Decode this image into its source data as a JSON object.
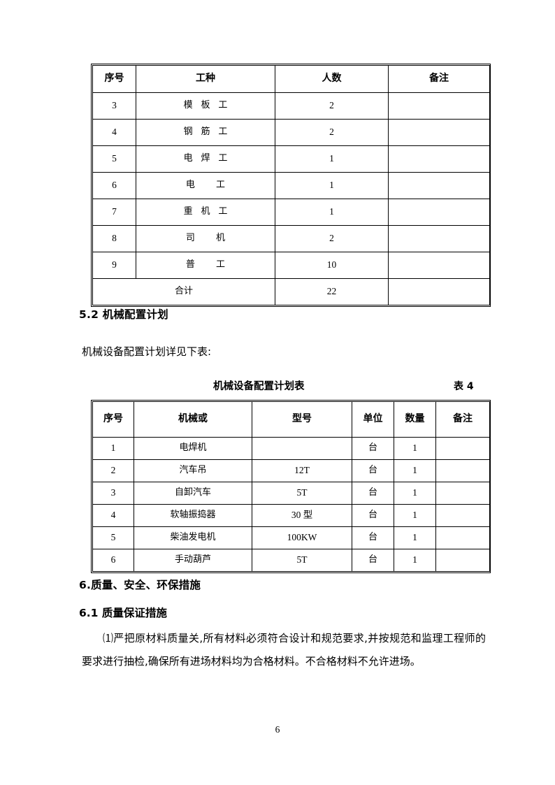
{
  "page": {
    "number": "6"
  },
  "table_labor": {
    "columns": [
      "序号",
      "工种",
      "人数",
      "备注"
    ],
    "rows": [
      {
        "no": "3",
        "trade": "模 板 工",
        "count": "2",
        "remark": ""
      },
      {
        "no": "4",
        "trade": "钢 筋 工",
        "count": "2",
        "remark": ""
      },
      {
        "no": "5",
        "trade": "电 焊 工",
        "count": "1",
        "remark": ""
      },
      {
        "no": "6",
        "trade": "电  工",
        "count": "1",
        "remark": ""
      },
      {
        "no": "7",
        "trade": "重 机 工",
        "count": "1",
        "remark": ""
      },
      {
        "no": "8",
        "trade": "司  机",
        "count": "2",
        "remark": ""
      },
      {
        "no": "9",
        "trade": "普  工",
        "count": "10",
        "remark": ""
      }
    ],
    "total_label": "合计",
    "total_count": "22",
    "total_remark": ""
  },
  "section_5_2": {
    "heading": "5.2 机械配置计划",
    "intro": "机械设备配置计划详见下表:"
  },
  "table_machine": {
    "caption": "机械设备配置计划表",
    "label": "表 4",
    "columns": [
      "序号",
      "机械或",
      "型号",
      "单位",
      "数量",
      "备注"
    ],
    "rows": [
      {
        "no": "1",
        "machine": "电焊机",
        "model": "",
        "unit": "台",
        "qty": "1",
        "remark": ""
      },
      {
        "no": "2",
        "machine": "汽车吊",
        "model": "12T",
        "unit": "台",
        "qty": "1",
        "remark": ""
      },
      {
        "no": "3",
        "machine": "自卸汽车",
        "model": "5T",
        "unit": "台",
        "qty": "1",
        "remark": ""
      },
      {
        "no": "4",
        "machine": "软轴振捣器",
        "model": "30 型",
        "unit": "台",
        "qty": "1",
        "remark": ""
      },
      {
        "no": "5",
        "machine": "柴油发电机",
        "model": "100KW",
        "unit": "台",
        "qty": "1",
        "remark": ""
      },
      {
        "no": "6",
        "machine": "手动葫芦",
        "model": "5T",
        "unit": "台",
        "qty": "1",
        "remark": ""
      }
    ]
  },
  "section_6": {
    "heading": "6.质量、安全、环保措施"
  },
  "section_6_1": {
    "heading": "6.1 质量保证措施",
    "paragraph": "⑴严把原材料质量关,所有材料必须符合设计和规范要求,并按规范和监理工程师的要求进行抽检,确保所有进场材料均为合格材料。不合格材料不允许进场。"
  }
}
